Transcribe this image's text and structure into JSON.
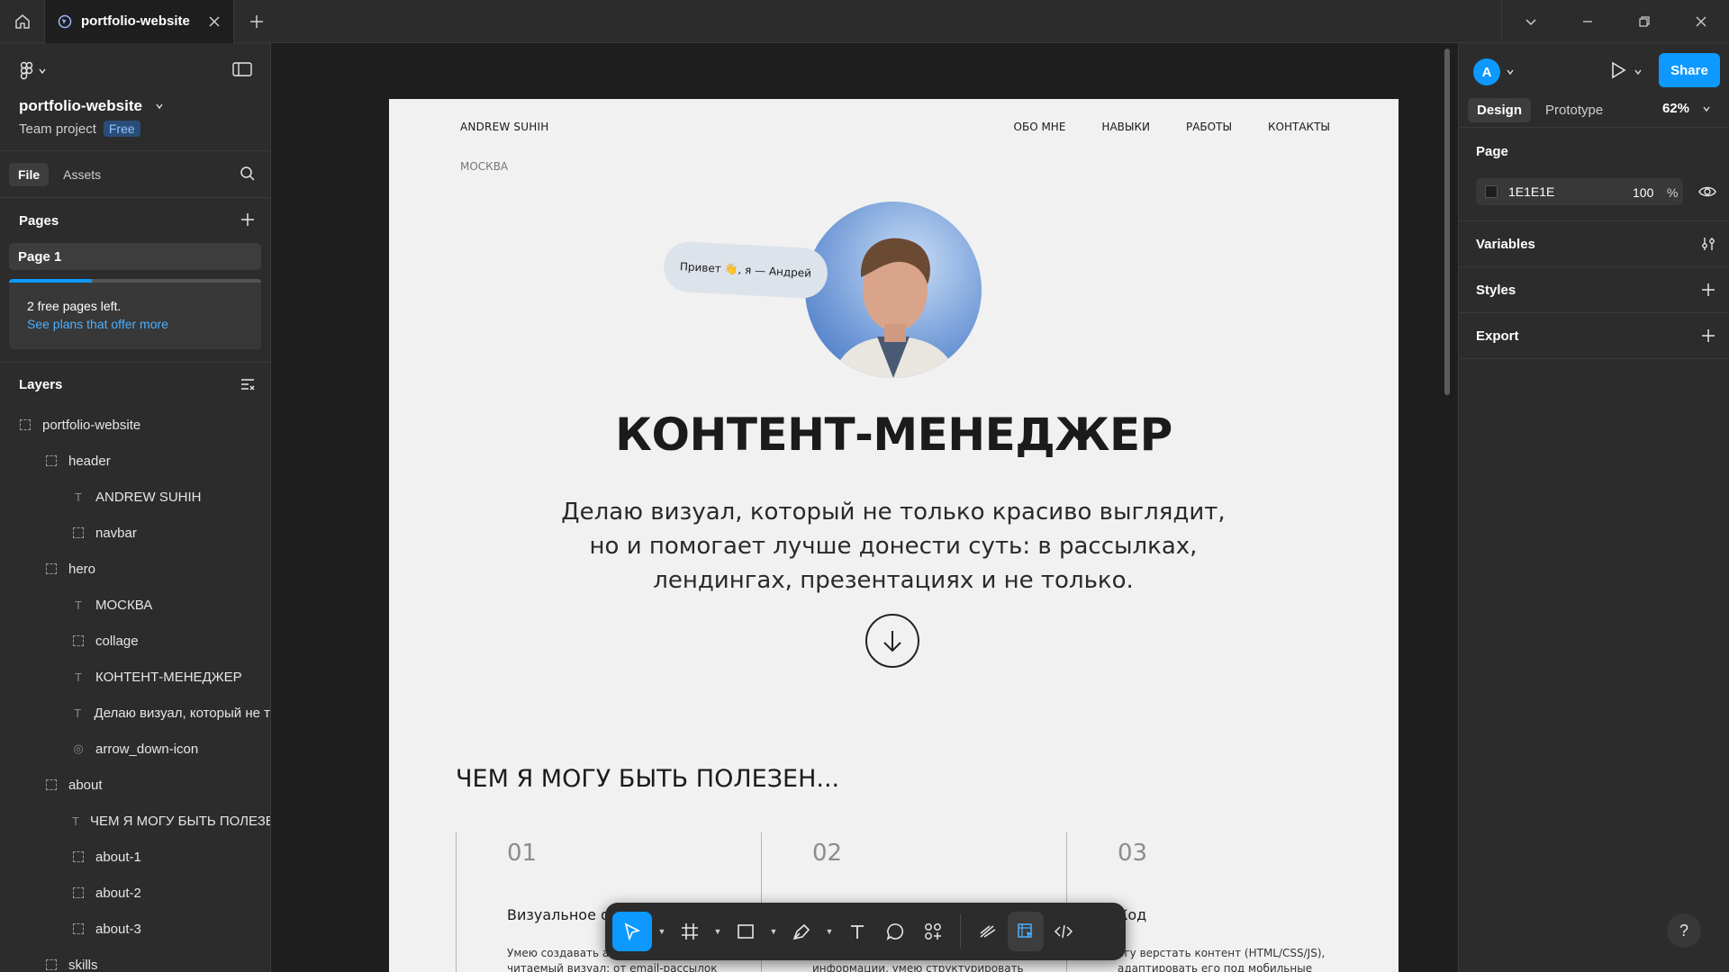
{
  "tab": {
    "title": "portfolio-website"
  },
  "left": {
    "project_name": "portfolio-website",
    "team": "Team project",
    "plan_badge": "Free",
    "tabs": {
      "file": "File",
      "assets": "Assets"
    },
    "pages_header": "Pages",
    "current_page": "Page 1",
    "free_notice": "2 free pages left.",
    "free_link": "See plans that offer more",
    "free_pages_used_fraction": 0.33,
    "layers_header": "Layers",
    "layers": [
      {
        "name": "portfolio-website",
        "type": "frame",
        "depth": 0
      },
      {
        "name": "header",
        "type": "frame",
        "depth": 1
      },
      {
        "name": "ANDREW SUHIH",
        "type": "text",
        "depth": 2
      },
      {
        "name": "navbar",
        "type": "frame",
        "depth": 2
      },
      {
        "name": "hero",
        "type": "frame",
        "depth": 1
      },
      {
        "name": "МОСКВА",
        "type": "text",
        "depth": 2
      },
      {
        "name": "collage",
        "type": "frame",
        "depth": 2
      },
      {
        "name": "КОНТЕНТ-МЕНЕДЖЕР",
        "type": "text",
        "depth": 2
      },
      {
        "name": "Делаю визуал, который не т",
        "type": "text",
        "depth": 2
      },
      {
        "name": "arrow_down-icon",
        "type": "component",
        "depth": 2
      },
      {
        "name": "about",
        "type": "frame",
        "depth": 1
      },
      {
        "name": "ЧЕМ Я МОГУ БЫТЬ ПОЛЕЗЕ",
        "type": "text",
        "depth": 2
      },
      {
        "name": "about-1",
        "type": "frame",
        "depth": 2
      },
      {
        "name": "about-2",
        "type": "frame",
        "depth": 2
      },
      {
        "name": "about-3",
        "type": "frame",
        "depth": 2
      },
      {
        "name": "skills",
        "type": "frame",
        "depth": 1
      }
    ]
  },
  "artboard": {
    "brand": "ANDREW SUHIH",
    "nav": [
      "ОБО МНЕ",
      "НАВЫКИ",
      "РАБОТЫ",
      "КОНТАКТЫ"
    ],
    "city": "МОСКВА",
    "bubble": "Привет 👋, я — Андрей",
    "title": "КОНТЕНТ-МЕНЕДЖЕР",
    "desc_lines": [
      "Делаю визуал, который не только красиво выглядит,",
      "но и помогает лучше донести суть: в рассылках,",
      "лендингах, презентациях и не только."
    ],
    "about_heading": "ЧЕМ Я МОГУ БЫТЬ ПОЛЕЗЕН...",
    "cards": [
      {
        "num": "01",
        "title": "Визуальное оф",
        "text": "Умею создавать а\nчитаемый визуал: от email-рассылок"
      },
      {
        "num": "02",
        "title": "",
        "text": "информации, умею структурировать"
      },
      {
        "num": "03",
        "title": "Код",
        "text": "огу верстать контент (HTML/CSS/JS),\nадаптировать его под мобильные"
      }
    ]
  },
  "right": {
    "avatar_letter": "A",
    "share": "Share",
    "tabs": {
      "design": "Design",
      "prototype": "Prototype"
    },
    "zoom": "62%",
    "page_header": "Page",
    "page_color": "1E1E1E",
    "page_opacity": "100",
    "percent_sign": "%",
    "variables": "Variables",
    "styles": "Styles",
    "export": "Export"
  },
  "help": "?",
  "colors": {
    "accent": "#0d99ff",
    "panel": "#2c2c2c",
    "canvas": "#1e1e1e",
    "artboard": "#f1f1f1"
  }
}
